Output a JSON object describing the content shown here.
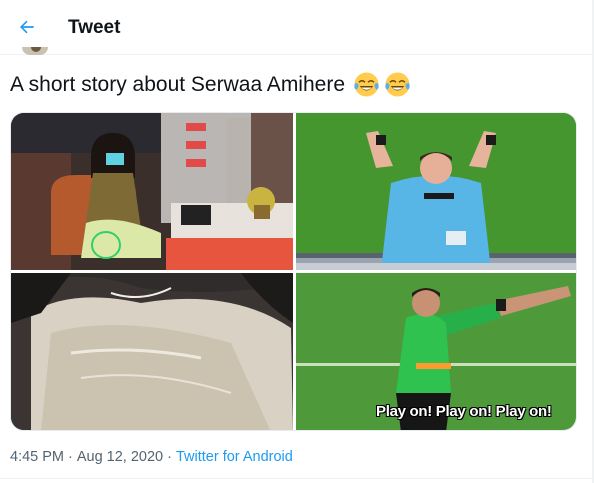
{
  "header": {
    "title": "Tweet",
    "back_icon": "arrow-left-icon"
  },
  "tweet": {
    "text": "A short story about Serwaa Amihere",
    "emojis": [
      "face-with-tears-of-joy",
      "face-with-tears-of-joy"
    ],
    "media": [
      {
        "icon": "photo-presenter-studio"
      },
      {
        "icon": "photo-referee-pointing-up"
      },
      {
        "icon": "photo-plastic-bag"
      },
      {
        "icon": "photo-referee-play-on",
        "caption": "Play on! Play on! Play on!"
      }
    ],
    "time": "4:45 PM",
    "date": "Aug 12, 2020",
    "source": "Twitter for Android"
  },
  "colors": {
    "accent": "#1d9bf0",
    "meta_text": "#536471",
    "text": "#0f1419"
  }
}
